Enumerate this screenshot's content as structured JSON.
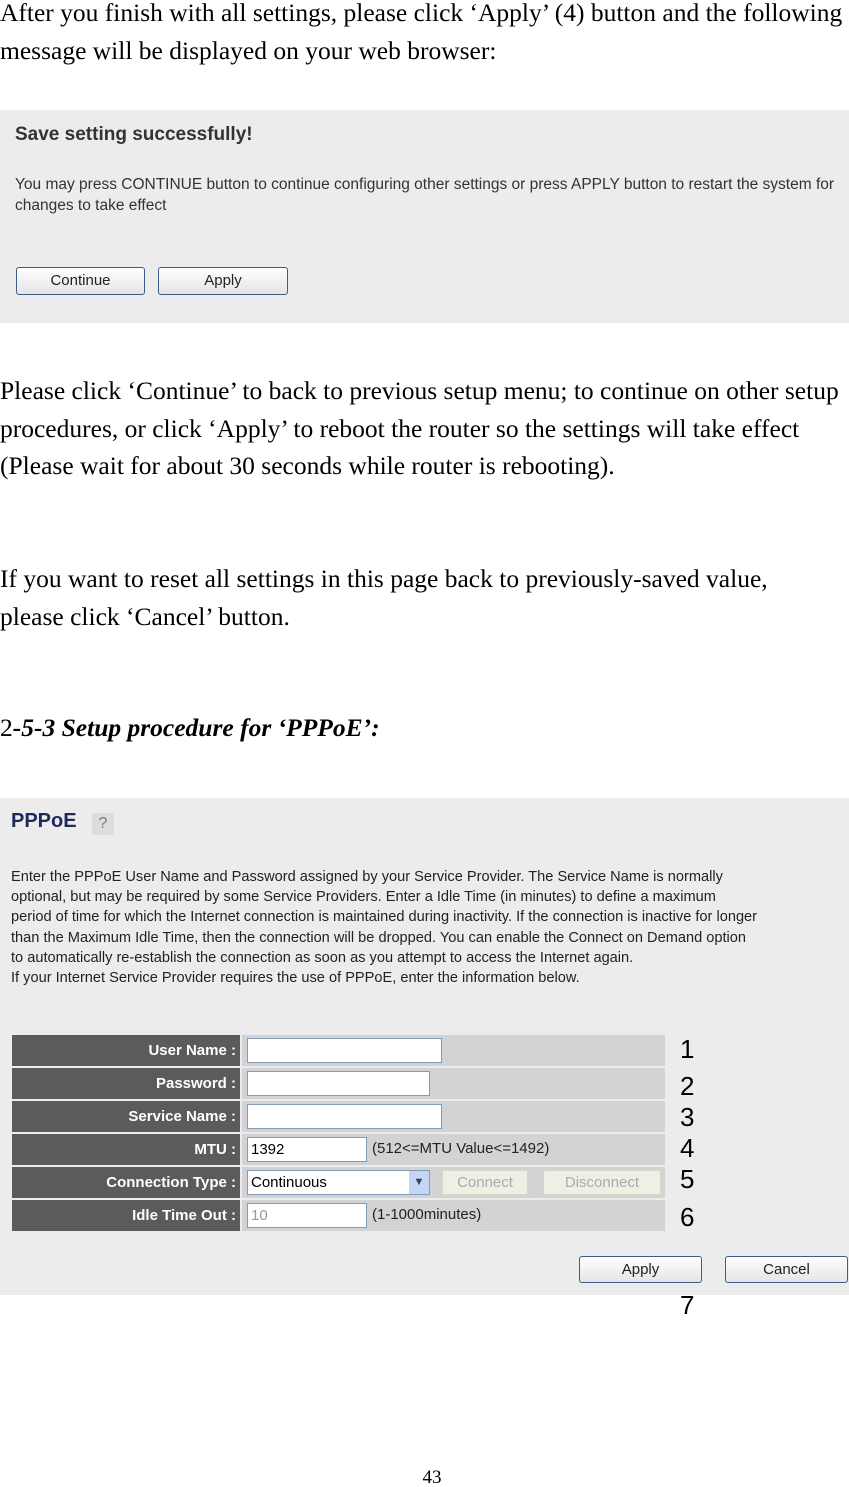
{
  "intro": "After you finish with all settings, please click ‘Apply’ (4) button and the following message will be displayed on your web browser:",
  "save_dialog": {
    "title": "Save setting successfully!",
    "message": "You may press CONTINUE button to continue configuring other settings or press APPLY button to restart the system for changes to take effect",
    "continue_label": "Continue",
    "apply_label": "Apply"
  },
  "para2": "Please click ‘Continue’ to back to previous setup menu; to continue on other setup procedures, or click ‘Apply’ to reboot the router so the settings will take effect (Please wait for about 30 seconds while router is rebooting).",
  "para3": "If you want to reset all settings in this page back to previously-saved value, please click ‘Cancel’ button.",
  "heading": {
    "prefix": "2",
    "rest": "-5-3 Setup procedure for ‘PPPoE’:"
  },
  "pppoe": {
    "title": "PPPoE",
    "help_icon": "help-icon",
    "description": [
      "Enter the PPPoE User Name and Password assigned by your Service Provider. The Service Name is normally",
      "optional, but may be required by some Service Providers. Enter a Idle Time (in minutes) to define a maximum",
      "period of time for which the Internet connection is maintained during inactivity. If the connection is inactive for longer",
      "than the Maximum Idle Time, then the connection will be dropped. You can enable the Connect on Demand option",
      "to automatically re-establish the connection as soon as you attempt to access the Internet again.",
      "If your Internet Service Provider requires the use of PPPoE, enter the information below."
    ],
    "fields": {
      "user_name": {
        "label": "User Name :",
        "value": ""
      },
      "password": {
        "label": "Password :",
        "value": ""
      },
      "service_name": {
        "label": "Service Name :",
        "value": ""
      },
      "mtu": {
        "label": "MTU :",
        "value": "1392",
        "hint": "(512<=MTU Value<=1492)"
      },
      "connection_type": {
        "label": "Connection Type :",
        "value": "Continuous",
        "connect_label": "Connect",
        "disconnect_label": "Disconnect"
      },
      "idle_time": {
        "label": "Idle Time Out :",
        "value": "10",
        "hint": "(1-1000minutes)"
      }
    },
    "apply_label": "Apply",
    "cancel_label": "Cancel"
  },
  "callouts": [
    "1",
    "2",
    "3",
    "4",
    "5",
    "6",
    "7"
  ],
  "page_number": "43"
}
